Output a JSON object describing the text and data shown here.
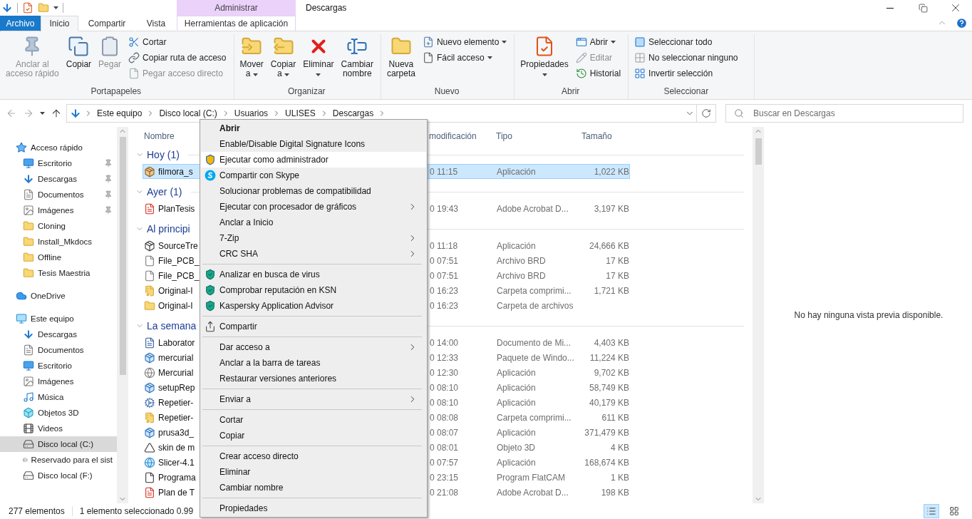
{
  "title_bar": {
    "contextual_header": "Administrar",
    "title": "Descargas"
  },
  "tabs": [
    {
      "label": "Archivo",
      "kind": "file",
      "selected": false
    },
    {
      "label": "Inicio",
      "kind": "tab",
      "selected": true
    },
    {
      "label": "Compartir",
      "kind": "tab",
      "selected": false
    },
    {
      "label": "Vista",
      "kind": "tab",
      "selected": false
    },
    {
      "label": "Herramientas de aplicación",
      "kind": "contextual",
      "selected": false
    }
  ],
  "ribbon": {
    "groups": [
      {
        "label": "Portapapeles",
        "items": [
          {
            "kind": "large",
            "lines": [
              "Anclar al",
              "acceso rápido"
            ],
            "dropdown": false,
            "disabled": true
          },
          {
            "kind": "large",
            "lines": [
              "Copiar"
            ],
            "dropdown": false,
            "disabled": false
          },
          {
            "kind": "large",
            "lines": [
              "Pegar"
            ],
            "dropdown": false,
            "disabled": true
          },
          {
            "kind": "small",
            "label": "Cortar",
            "dropdown": false,
            "disabled": false
          },
          {
            "kind": "small",
            "label": "Copiar ruta de acceso",
            "dropdown": false,
            "disabled": false
          },
          {
            "kind": "small",
            "label": "Pegar acceso directo",
            "dropdown": false,
            "disabled": true
          }
        ]
      },
      {
        "label": "Organizar",
        "items": [
          {
            "kind": "large",
            "lines": [
              "Mover",
              "a"
            ],
            "dropdown": true,
            "disabled": false
          },
          {
            "kind": "large",
            "lines": [
              "Copiar",
              "a"
            ],
            "dropdown": true,
            "disabled": false
          },
          {
            "kind": "large",
            "lines": [
              "Eliminar"
            ],
            "dropdown": true,
            "disabled": false
          },
          {
            "kind": "large",
            "lines": [
              "Cambiar",
              "nombre"
            ],
            "dropdown": false,
            "disabled": false
          }
        ]
      },
      {
        "label": "Nuevo",
        "items": [
          {
            "kind": "large",
            "lines": [
              "Nueva",
              "carpeta"
            ],
            "dropdown": false,
            "disabled": false
          },
          {
            "kind": "small",
            "label": "Nuevo elemento",
            "dropdown": true,
            "disabled": false
          },
          {
            "kind": "small",
            "label": "Fácil acceso",
            "dropdown": true,
            "disabled": false
          }
        ]
      },
      {
        "label": "Abrir",
        "items": [
          {
            "kind": "large",
            "lines": [
              "Propiedades"
            ],
            "dropdown": true,
            "disabled": false
          },
          {
            "kind": "small",
            "label": "Abrir",
            "dropdown": true,
            "disabled": false
          },
          {
            "kind": "small",
            "label": "Editar",
            "dropdown": false,
            "disabled": true
          },
          {
            "kind": "small",
            "label": "Historial",
            "dropdown": false,
            "disabled": false
          }
        ]
      },
      {
        "label": "Seleccionar",
        "items": [
          {
            "kind": "small",
            "label": "Seleccionar todo",
            "dropdown": false,
            "disabled": false
          },
          {
            "kind": "small",
            "label": "No seleccionar ninguno",
            "dropdown": false,
            "disabled": false
          },
          {
            "kind": "small",
            "label": "Invertir selección",
            "dropdown": false,
            "disabled": false
          }
        ]
      }
    ]
  },
  "address": {
    "path": [
      "Este equipo",
      "Disco local (C:)",
      "Usuarios",
      "ULISES",
      "Descargas"
    ]
  },
  "search": {
    "placeholder": "Buscar en Descargas"
  },
  "nav": [
    {
      "label": "Acceso rápido",
      "selected": false,
      "children": [
        {
          "label": "Escritorio",
          "pinned": true,
          "selected": false
        },
        {
          "label": "Descargas",
          "pinned": true,
          "selected": false
        },
        {
          "label": "Documentos",
          "pinned": true,
          "selected": false
        },
        {
          "label": "Imágenes",
          "pinned": true,
          "selected": false
        },
        {
          "label": "Cloning",
          "pinned": false,
          "selected": false
        },
        {
          "label": "Install_Mkdocs",
          "pinned": false,
          "selected": false
        },
        {
          "label": "Offline",
          "pinned": false,
          "selected": false
        },
        {
          "label": "Tesis Maestria",
          "pinned": false,
          "selected": false
        }
      ]
    },
    {
      "label": "OneDrive",
      "selected": false
    },
    {
      "label": "Este equipo",
      "selected": false,
      "children": [
        {
          "label": "Descargas",
          "selected": false
        },
        {
          "label": "Documentos",
          "selected": false
        },
        {
          "label": "Escritorio",
          "selected": false
        },
        {
          "label": "Imágenes",
          "selected": false
        },
        {
          "label": "Música",
          "selected": false
        },
        {
          "label": "Objetos 3D",
          "selected": false
        },
        {
          "label": "Videos",
          "selected": false
        },
        {
          "label": "Disco local (C:)",
          "selected": true
        },
        {
          "label": "Reservado para el sist",
          "selected": false
        },
        {
          "label": "Disco local (F:)",
          "selected": false
        }
      ]
    }
  ],
  "columns": [
    "Nombre",
    "modificación",
    "Tipo",
    "Tamaño"
  ],
  "groups": [
    {
      "label": "Hoy (1)",
      "rows": [
        {
          "name": "filmora_s",
          "date": "0 11:15",
          "type": "Aplicación",
          "size": "1,022 KB",
          "selected": true
        }
      ]
    },
    {
      "label": "Ayer (1)",
      "rows": [
        {
          "name": "PlanTesis",
          "date": "0 19:43",
          "type": "Adobe Acrobat D...",
          "size": "3,197 KB",
          "selected": false
        }
      ]
    },
    {
      "label": "Al principi",
      "rows": [
        {
          "name": "SourceTre",
          "date": "0 11:18",
          "type": "Aplicación",
          "size": "24,666 KB",
          "selected": false
        },
        {
          "name": "File_PCB_",
          "date": "0 07:51",
          "type": "Archivo BRD",
          "size": "17 KB",
          "selected": false
        },
        {
          "name": "File_PCB_",
          "date": "0 07:51",
          "type": "Archivo BRD",
          "size": "17 KB",
          "selected": false
        },
        {
          "name": "Original-I",
          "date": "0 16:23",
          "type": "Carpeta comprimi...",
          "size": "1,721 KB",
          "selected": false
        },
        {
          "name": "Original-I",
          "date": "0 16:23",
          "type": "Carpeta de archivos",
          "size": "",
          "selected": false
        }
      ]
    },
    {
      "label": "La semana",
      "rows": [
        {
          "name": "Laborator",
          "date": "0 14:00",
          "type": "Documento de Mi...",
          "size": "4,403 KB",
          "selected": false
        },
        {
          "name": "mercurial",
          "date": "0 12:33",
          "type": "Paquete de Windo...",
          "size": "11,224 KB",
          "selected": false
        },
        {
          "name": "Mercurial",
          "date": "0 12:30",
          "type": "Aplicación",
          "size": "9,702 KB",
          "selected": false
        },
        {
          "name": "setupRep",
          "date": "0 08:10",
          "type": "Aplicación",
          "size": "58,749 KB",
          "selected": false
        },
        {
          "name": "Repetier-",
          "date": "0 08:10",
          "type": "Aplicación",
          "size": "40,179 KB",
          "selected": false
        },
        {
          "name": "Repetier-",
          "date": "0 08:08",
          "type": "Carpeta comprimi...",
          "size": "611 KB",
          "selected": false
        },
        {
          "name": "prusa3d_",
          "date": "0 08:07",
          "type": "Aplicación",
          "size": "371,479 KB",
          "selected": false
        },
        {
          "name": "skin de m",
          "date": "0 08:01",
          "type": "Objeto 3D",
          "size": "4 KB",
          "selected": false
        },
        {
          "name": "Slicer-4.1",
          "date": "0 07:57",
          "type": "Aplicación",
          "size": "168,674 KB",
          "selected": false
        },
        {
          "name": "Programa",
          "date": "0 23:15",
          "type": "Program FlatCAM",
          "size": "1 KB",
          "selected": false
        },
        {
          "name": "Plan de T",
          "date": "0 21:08",
          "type": "Adobe Acrobat D...",
          "size": "198 KB",
          "selected": false
        }
      ]
    }
  ],
  "preview": {
    "message": "No hay ninguna vista previa disponible."
  },
  "status_bar": {
    "count": "277 elementos",
    "selection": "1 elemento seleccionado 0.99",
    "views": [
      {
        "selected": true
      },
      {
        "selected": false
      }
    ]
  },
  "context_menu": [
    {
      "kind": "item",
      "label": "Abrir",
      "default": true,
      "highlighted": false,
      "submenu": false
    },
    {
      "kind": "item",
      "label": "Enable/Disable Digital Signature Icons",
      "default": false,
      "highlighted": false,
      "submenu": false
    },
    {
      "kind": "item",
      "label": "Ejecutar como administrador",
      "default": false,
      "highlighted": true,
      "submenu": false
    },
    {
      "kind": "item",
      "label": "Compartir con Skype",
      "default": false,
      "highlighted": false,
      "submenu": false
    },
    {
      "kind": "item",
      "label": "Solucionar problemas de compatibilidad",
      "default": false,
      "highlighted": false,
      "submenu": false
    },
    {
      "kind": "item",
      "label": "Ejecutar con procesador de gráficos",
      "default": false,
      "highlighted": false,
      "submenu": true
    },
    {
      "kind": "item",
      "label": "Anclar a Inicio",
      "default": false,
      "highlighted": false,
      "submenu": false
    },
    {
      "kind": "item",
      "label": "7-Zip",
      "default": false,
      "highlighted": false,
      "submenu": true
    },
    {
      "kind": "item",
      "label": "CRC SHA",
      "default": false,
      "highlighted": false,
      "submenu": true
    },
    {
      "kind": "separator"
    },
    {
      "kind": "item",
      "label": "Analizar en busca de virus",
      "default": false,
      "highlighted": false,
      "submenu": false
    },
    {
      "kind": "item",
      "label": "Comprobar reputación en KSN",
      "default": false,
      "highlighted": false,
      "submenu": false
    },
    {
      "kind": "item",
      "label": "Kaspersky Application Advisor",
      "default": false,
      "highlighted": false,
      "submenu": false
    },
    {
      "kind": "separator"
    },
    {
      "kind": "item",
      "label": "Compartir",
      "default": false,
      "highlighted": false,
      "submenu": false
    },
    {
      "kind": "separator"
    },
    {
      "kind": "item",
      "label": "Dar acceso a",
      "default": false,
      "highlighted": false,
      "submenu": true
    },
    {
      "kind": "item",
      "label": "Anclar a la barra de tareas",
      "default": false,
      "highlighted": false,
      "submenu": false
    },
    {
      "kind": "item",
      "label": "Restaurar versiones anteriores",
      "default": false,
      "highlighted": false,
      "submenu": false
    },
    {
      "kind": "separator"
    },
    {
      "kind": "item",
      "label": "Enviar a",
      "default": false,
      "highlighted": false,
      "submenu": true
    },
    {
      "kind": "separator"
    },
    {
      "kind": "item",
      "label": "Cortar",
      "default": false,
      "highlighted": false,
      "submenu": false
    },
    {
      "kind": "item",
      "label": "Copiar",
      "default": false,
      "highlighted": false,
      "submenu": false
    },
    {
      "kind": "separator"
    },
    {
      "kind": "item",
      "label": "Crear acceso directo",
      "default": false,
      "highlighted": false,
      "submenu": false
    },
    {
      "kind": "item",
      "label": "Eliminar",
      "default": false,
      "highlighted": false,
      "submenu": false
    },
    {
      "kind": "item",
      "label": "Cambiar nombre",
      "default": false,
      "highlighted": false,
      "submenu": false
    },
    {
      "kind": "separator"
    },
    {
      "kind": "item",
      "label": "Propiedades",
      "default": false,
      "highlighted": false,
      "submenu": false
    }
  ]
}
